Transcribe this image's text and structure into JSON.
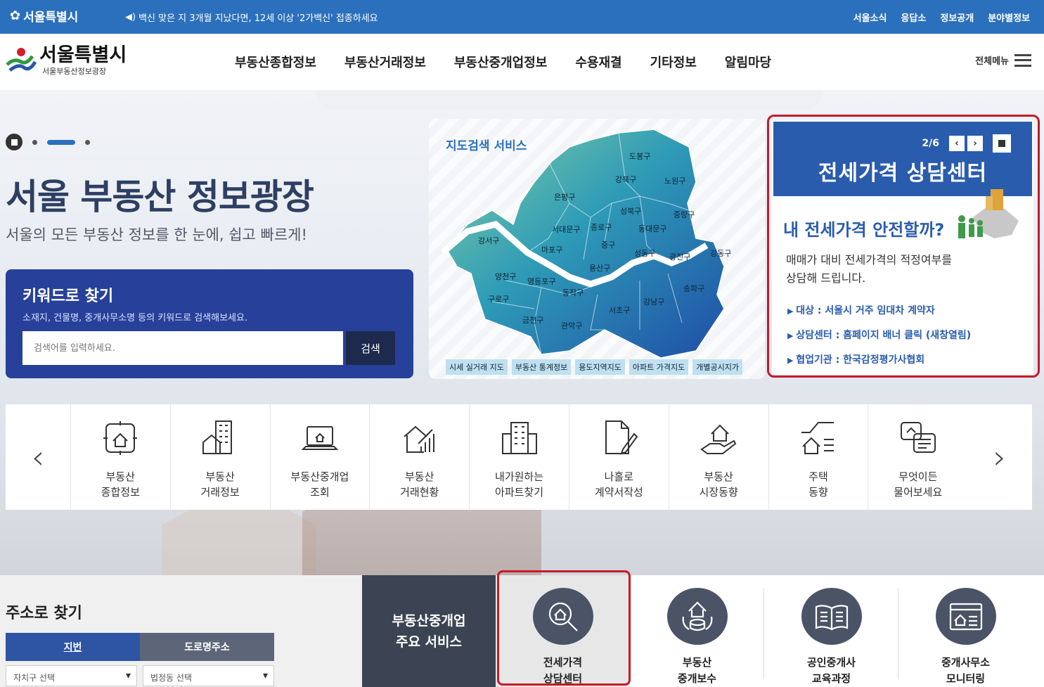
{
  "topbar": {
    "logo": "서울특별시",
    "notice": "백신 맞은 지 3개월 지났다면, 12세 이상 '2가백신' 접종하세요",
    "links": [
      "서울소식",
      "응답소",
      "정보공개",
      "분야별정보"
    ]
  },
  "header": {
    "brand": "서울특별시",
    "brand_sub": "서울부동산정보광장",
    "gnb": [
      "부동산종합정보",
      "부동산거래정보",
      "부동산중개업정보",
      "수용재결",
      "기타정보",
      "알림마당"
    ],
    "allmenu": "전체메뉴"
  },
  "hero": {
    "title": "서울 부동산 정보광장",
    "subtitle": "서울의 모든 부동산 정보를 한 눈에, 쉽고 빠르게!",
    "keyword": {
      "title": "키워드로 찾기",
      "desc": "소재지, 건물명, 중개사무소명 등의 키워드로 검색해보세요.",
      "placeholder": "검색어를 입력하세요.",
      "button": "검색"
    }
  },
  "map": {
    "title": "지도검색 서비스",
    "districts": [
      "도봉구",
      "강북구",
      "노원구",
      "은평구",
      "성북구",
      "중랑구",
      "서대문구",
      "종로구",
      "동대문구",
      "강서구",
      "마포구",
      "중구",
      "성동구",
      "광진구",
      "강동구",
      "용산구",
      "양천구",
      "영등포구",
      "송파구",
      "구로구",
      "동작구",
      "강남구",
      "서초구",
      "금천구",
      "관악구"
    ],
    "tabs": [
      "시세 실거래 지도",
      "부동산 통계정보",
      "용도지역지도",
      "아파트 가격지도",
      "개별공시지가"
    ]
  },
  "jeonse": {
    "page": "2/6",
    "title": "전세가격 상담센터",
    "question": "내 전세가격 안전할까?",
    "desc1": "매매가 대비 전세가격의 적정여부를",
    "desc2": "상담해 드립니다.",
    "items": [
      "대상 : 서울시 거주 임대차 계약자",
      "상담센터 : 홈페이지 배너 클릭 (새창열림)",
      "협업기관 : 한국감정평가사협회"
    ]
  },
  "quick": [
    {
      "l1": "부동산",
      "l2": "종합정보",
      "icon": "house-target-icon"
    },
    {
      "l1": "부동산",
      "l2": "거래정보",
      "icon": "buildings-icon"
    },
    {
      "l1": "부동산중개업",
      "l2": "조회",
      "icon": "laptop-house-icon"
    },
    {
      "l1": "부동산",
      "l2": "거래현황",
      "icon": "chart-house-icon"
    },
    {
      "l1": "내가원하는",
      "l2": "아파트찾기",
      "icon": "apartment-icon"
    },
    {
      "l1": "나홀로",
      "l2": "계약서작성",
      "icon": "document-pen-icon"
    },
    {
      "l1": "부동산",
      "l2": "시장동향",
      "icon": "hand-house-icon"
    },
    {
      "l1": "주택",
      "l2": "동향",
      "icon": "trend-house-icon"
    },
    {
      "l1": "무엇이든",
      "l2": "물어보세요",
      "icon": "chat-icon"
    }
  ],
  "address": {
    "title": "주소로 찾기",
    "tab1": "지번",
    "tab2": "도로명주소",
    "sel1": "자치구 선택",
    "sel2": "법정동 선택"
  },
  "services": {
    "label1": "부동산중개업",
    "label2": "주요 서비스",
    "items": [
      {
        "l1": "전세가격",
        "l2": "상담센터"
      },
      {
        "l1": "부동산",
        "l2": "중개보수"
      },
      {
        "l1": "공인중개사",
        "l2": "교육과정"
      },
      {
        "l1": "중개사무소",
        "l2": "모니터링"
      }
    ]
  }
}
